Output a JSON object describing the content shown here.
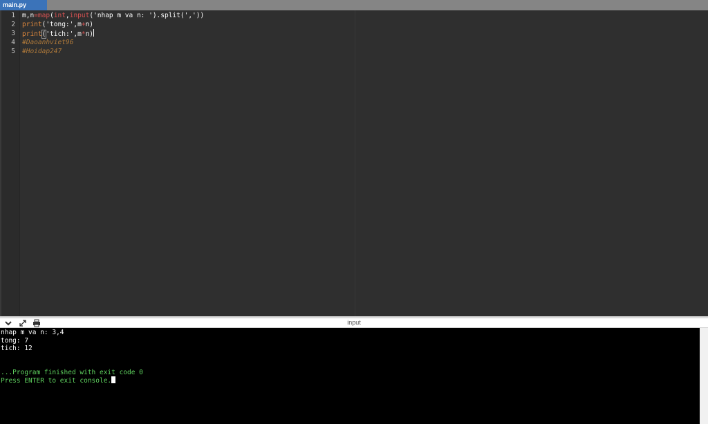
{
  "tabs": [
    {
      "label": "main.py",
      "active": true
    }
  ],
  "editor": {
    "line_numbers": [
      "1",
      "2",
      "3",
      "4",
      "5"
    ],
    "lines": [
      [
        {
          "text": "m,n",
          "kind": "txt"
        },
        {
          "text": "=",
          "kind": "op"
        },
        {
          "text": "map",
          "kind": "op"
        },
        {
          "text": "(",
          "kind": "txt"
        },
        {
          "text": "int",
          "kind": "op"
        },
        {
          "text": ",",
          "kind": "txt"
        },
        {
          "text": "input",
          "kind": "op"
        },
        {
          "text": "('nhap m va n: ').split(',')) ",
          "kind": "txt"
        }
      ],
      [
        {
          "text": "print",
          "kind": "kw"
        },
        {
          "text": "('tong:',m",
          "kind": "txt"
        },
        {
          "text": "+",
          "kind": "op"
        },
        {
          "text": "n)",
          "kind": "txt"
        }
      ],
      [
        {
          "text": "print",
          "kind": "kw"
        },
        {
          "text": "(",
          "kind": "txt"
        },
        {
          "text": "'tich:',m",
          "kind": "txt"
        },
        {
          "text": "*",
          "kind": "op"
        },
        {
          "text": "n)",
          "kind": "txt"
        }
      ],
      [
        {
          "text": "#Daoanhviet96",
          "kind": "cmt"
        }
      ],
      [
        {
          "text": "#Hoidap247",
          "kind": "cmt"
        }
      ]
    ]
  },
  "console": {
    "title": "input",
    "icons": [
      "chevron-down-icon",
      "expand-icon",
      "printer-icon"
    ],
    "output_lines": [
      {
        "text": "nhap m va n: 3,4",
        "kind": "out"
      },
      {
        "text": "tong: 7",
        "kind": "out"
      },
      {
        "text": "tich: 12",
        "kind": "out"
      },
      {
        "text": "",
        "kind": "out"
      },
      {
        "text": "",
        "kind": "out"
      },
      {
        "text": "...Program finished with exit code 0",
        "kind": "sys"
      },
      {
        "text": "Press ENTER to exit console.",
        "kind": "sys"
      }
    ]
  },
  "colors": {
    "tab_active": "#3b73b9",
    "editor_bg": "#2f2f2f",
    "keyword": "#e0893d",
    "operator": "#d65252",
    "comment": "#b07a3a",
    "console_bg": "#000000",
    "console_system": "#5fd35f"
  }
}
